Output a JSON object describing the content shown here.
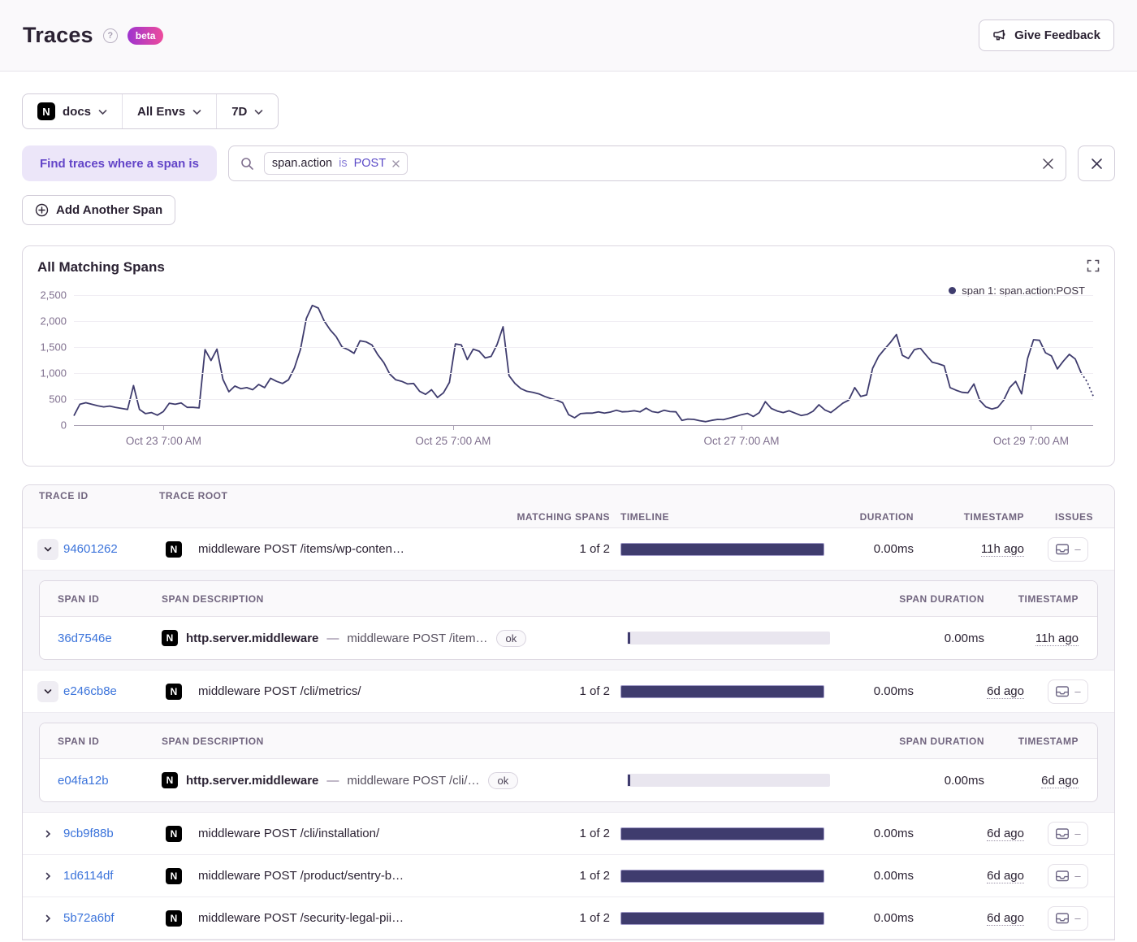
{
  "colors": {
    "line": "#3f3c6e",
    "bar_fill": "#3f3c6e",
    "accent_purple": "#6345c8",
    "link_blue": "#3c74db",
    "beta_gradient_start": "#9e34cf",
    "beta_gradient_end": "#ee4b9c"
  },
  "header": {
    "title": "Traces",
    "beta_label": "beta",
    "feedback_label": "Give Feedback"
  },
  "filters": {
    "project": "docs",
    "environment": "All Envs",
    "period": "7D"
  },
  "span_search": {
    "label": "Find traces where a span is",
    "token": {
      "key": "span.action",
      "op": "is",
      "value": "POST"
    },
    "add_button_label": "Add Another Span"
  },
  "chart_data": {
    "type": "line",
    "title": "All Matching Spans",
    "legend": "span 1: span.action:POST",
    "xlabel": "",
    "ylabel": "",
    "ylim": [
      0,
      2500
    ],
    "grid": true,
    "legend_position": "top-right",
    "y_ticks": [
      "0",
      "500",
      "1,000",
      "1,500",
      "2,000",
      "2,500"
    ],
    "x_ticks": [
      {
        "label": "Oct 23 7:00 AM",
        "pos": 0.088
      },
      {
        "label": "Oct 25 7:00 AM",
        "pos": 0.372
      },
      {
        "label": "Oct 27 7:00 AM",
        "pos": 0.655
      },
      {
        "label": "Oct 29 7:00 AM",
        "pos": 0.939
      }
    ],
    "series": [
      {
        "name": "span 1: span.action:POST",
        "values": [
          180,
          400,
          430,
          400,
          370,
          350,
          365,
          340,
          320,
          300,
          760,
          300,
          220,
          240,
          190,
          260,
          420,
          400,
          425,
          340,
          340,
          330,
          1450,
          1240,
          1460,
          880,
          640,
          750,
          700,
          720,
          680,
          780,
          720,
          900,
          840,
          800,
          870,
          1100,
          1450,
          2050,
          2300,
          2250,
          2000,
          1830,
          1700,
          1500,
          1450,
          1380,
          1620,
          1600,
          1540,
          1350,
          1200,
          980,
          870,
          840,
          790,
          800,
          650,
          590,
          680,
          530,
          620,
          820,
          1560,
          1540,
          1260,
          1460,
          1420,
          1290,
          1320,
          1550,
          1890,
          950,
          800,
          700,
          650,
          630,
          600,
          550,
          510,
          480,
          430,
          200,
          140,
          220,
          230,
          230,
          255,
          230,
          250,
          285,
          255,
          260,
          275,
          255,
          325,
          260,
          240,
          285,
          260,
          255,
          90,
          115,
          110,
          85,
          65,
          90,
          110,
          105,
          135,
          165,
          200,
          225,
          165,
          240,
          450,
          320,
          270,
          240,
          275,
          230,
          185,
          205,
          265,
          390,
          290,
          240,
          330,
          420,
          480,
          720,
          550,
          580,
          1090,
          1320,
          1460,
          1590,
          1740,
          1340,
          1280,
          1450,
          1480,
          1340,
          1210,
          1180,
          1140,
          720,
          670,
          630,
          620,
          790,
          470,
          350,
          310,
          340,
          480,
          720,
          840,
          600,
          1280,
          1640,
          1630,
          1390,
          1330,
          1080,
          1230,
          1360,
          1270,
          1000
        ],
        "dashed_tail": [
          830,
          560
        ]
      }
    ]
  },
  "table": {
    "columns": [
      "TRACE ID",
      "TRACE ROOT",
      "MATCHING SPANS",
      "TIMELINE",
      "DURATION",
      "TIMESTAMP",
      "ISSUES"
    ],
    "span_columns": [
      "SPAN ID",
      "SPAN DESCRIPTION",
      "SPAN DURATION",
      "TIMESTAMP"
    ],
    "desc_separator": "—",
    "no_issues_label": "–",
    "rows": [
      {
        "trace_id": "94601262",
        "root": "middleware POST /items/wp-conten…",
        "matching": "1 of 2",
        "duration": "0.00ms",
        "timestamp": "11h ago",
        "expanded": true,
        "spans": [
          {
            "span_id": "36d7546e",
            "op": "http.server.middleware",
            "desc": "middleware POST /item…",
            "status": "ok",
            "duration": "0.00ms",
            "timestamp": "11h ago"
          }
        ]
      },
      {
        "trace_id": "e246cb8e",
        "root": "middleware POST /cli/metrics/",
        "matching": "1 of 2",
        "duration": "0.00ms",
        "timestamp": "6d ago",
        "expanded": true,
        "spans": [
          {
            "span_id": "e04fa12b",
            "op": "http.server.middleware",
            "desc": "middleware POST /cli/…",
            "status": "ok",
            "duration": "0.00ms",
            "timestamp": "6d ago"
          }
        ]
      },
      {
        "trace_id": "9cb9f88b",
        "root": "middleware POST /cli/installation/",
        "matching": "1 of 2",
        "duration": "0.00ms",
        "timestamp": "6d ago",
        "expanded": false,
        "spans": []
      },
      {
        "trace_id": "1d6114df",
        "root": "middleware POST /product/sentry-b…",
        "matching": "1 of 2",
        "duration": "0.00ms",
        "timestamp": "6d ago",
        "expanded": false,
        "spans": []
      },
      {
        "trace_id": "5b72a6bf",
        "root": "middleware POST /security-legal-pii…",
        "matching": "1 of 2",
        "duration": "0.00ms",
        "timestamp": "6d ago",
        "expanded": false,
        "spans": []
      }
    ]
  }
}
